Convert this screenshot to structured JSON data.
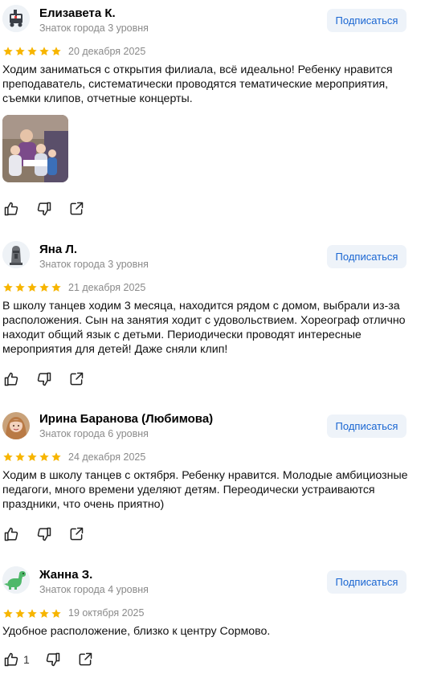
{
  "reviews": [
    {
      "name": "Елизавета К.",
      "level": "Знаток города 3 уровня",
      "subscribe": "Подписаться",
      "rating": 5,
      "date": "20 декабря 2025",
      "text": "Ходим заниматься с открытия филиала, всё идеально! Ребенку нравится преподаватель, систематически проводятся тематические мероприятия, съемки клипов, отчетные концерты.",
      "avatar_icon": "train-icon",
      "has_photo": true,
      "likes": ""
    },
    {
      "name": "Яна Л.",
      "level": "Знаток города 3 уровня",
      "subscribe": "Подписаться",
      "rating": 5,
      "date": "21 декабря 2025",
      "text": "В школу танцев ходим 3 месяца, находится рядом с домом, выбрали из-за расположения. Сын на занятия ходит с удовольствием. Хореограф отлично находит общий язык с детьми. Периодически проводят интересные мероприятия для детей! Даже сняли клип!",
      "avatar_icon": "statue-icon",
      "likes": ""
    },
    {
      "name": "Ирина Баранова (Любимова)",
      "level": "Знаток города 6 уровня",
      "subscribe": "Подписаться",
      "rating": 5,
      "date": "24 декабря 2025",
      "text": "Ходим в школу танцев с октября. Ребенку нравится. Молодые амбициозные педагоги, много времени уделяют детям. Переодически устраиваются праздники, что очень приятно)",
      "avatar_icon": "user-photo",
      "likes": ""
    },
    {
      "name": "Жанна З.",
      "level": "Знаток города 4 уровня",
      "subscribe": "Подписаться",
      "rating": 5,
      "date": "19 октября 2025",
      "text": "Удобное расположение, близко к центру Сормово.",
      "avatar_icon": "dinosaur-icon",
      "likes": "1"
    }
  ],
  "colors": {
    "star": "#f7b500",
    "link": "#1a66d2",
    "button_bg": "#eef3f9",
    "muted": "#8a8a8a"
  }
}
